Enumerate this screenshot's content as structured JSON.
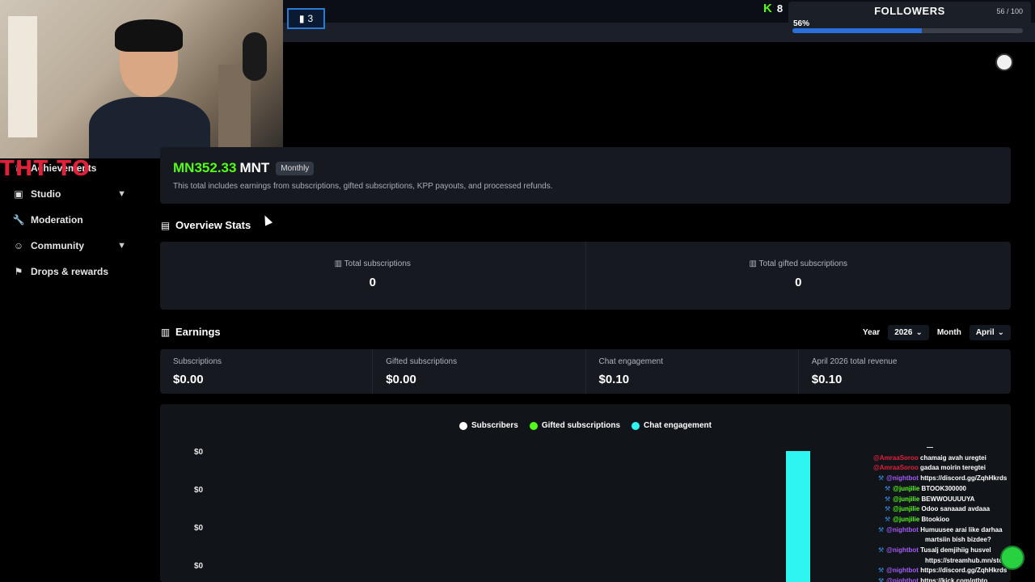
{
  "stream_overlay": {
    "tab_badge_count": "3",
    "kick_viewer_count": "8",
    "followers": {
      "title": "FOLLOWERS",
      "count": "56 / 100",
      "percent_label": "56%",
      "progress": 0.56
    },
    "logo_text": "THT TO"
  },
  "sidebar": {
    "items": [
      {
        "label": "Achievements",
        "icon": "trophy-icon"
      },
      {
        "label": "Studio",
        "icon": "studio-icon",
        "expandable": true
      },
      {
        "label": "Moderation",
        "icon": "wrench-icon"
      },
      {
        "label": "Community",
        "icon": "users-icon",
        "expandable": true
      },
      {
        "label": "Drops & rewards",
        "icon": "gift-icon"
      }
    ]
  },
  "total": {
    "prefix": "MN",
    "amount": "352.33",
    "currency": "MNT",
    "period_badge": "Monthly",
    "note": "This total includes earnings from subscriptions, gifted subscriptions, KPP payouts, and processed refunds."
  },
  "overview": {
    "title": "Overview Stats",
    "stats": [
      {
        "label": "Total subscriptions",
        "value": "0"
      },
      {
        "label": "Total gifted subscriptions",
        "value": "0"
      }
    ]
  },
  "earnings": {
    "title": "Earnings",
    "year_label": "Year",
    "year_value": "2026",
    "month_label": "Month",
    "month_value": "April",
    "cards": [
      {
        "label": "Subscriptions",
        "value": "$0.00"
      },
      {
        "label": "Gifted subscriptions",
        "value": "$0.00"
      },
      {
        "label": "Chat engagement",
        "value": "$0.10"
      },
      {
        "label": "April 2026 total revenue",
        "value": "$0.10"
      }
    ]
  },
  "chart_data": {
    "type": "bar",
    "title": "",
    "xlabel": "",
    "ylabel": "",
    "y_tick_labels": [
      "$0",
      "$0",
      "$0",
      "$0"
    ],
    "series": [
      {
        "name": "Subscribers",
        "color": "#ffffff",
        "values": [
          0
        ]
      },
      {
        "name": "Gifted subscriptions",
        "color": "#53fc18",
        "values": [
          0
        ]
      },
      {
        "name": "Chat engagement",
        "color": "#2ff5f0",
        "values": [
          0.1
        ]
      }
    ],
    "legend_position": "top-center"
  },
  "chat": [
    {
      "user": "",
      "text": "—",
      "role": "plain"
    },
    {
      "user": "@AmraaSoroo",
      "text": "chamaig avah uregtei",
      "role": "red"
    },
    {
      "user": "@AmraaSoroo",
      "text": "gadaa moirin teregtei",
      "role": "red"
    },
    {
      "user": "@nightbot",
      "text": "https://discord.gg/ZqhHkrds",
      "role": "mod-purple"
    },
    {
      "user": "@junjilie",
      "text": "BTOOK300000",
      "role": "mod-green"
    },
    {
      "user": "@junjilie",
      "text": "BEWWOUUUUYA",
      "role": "mod-green"
    },
    {
      "user": "@junjilie",
      "text": "Odoo sanaaad avdaaa",
      "role": "mod-green"
    },
    {
      "user": "@junjilie",
      "text": "Btookioo",
      "role": "mod-green"
    },
    {
      "user": "@nightbot",
      "text": "Humuusee arai like darhaa",
      "role": "mod-purple"
    },
    {
      "user": "",
      "text": "martsiin bish bizdee?",
      "role": "cont"
    },
    {
      "user": "@nightbot",
      "text": "Tusalj demjihiig husvel",
      "role": "mod-purple"
    },
    {
      "user": "",
      "text": "https://streamhub.mn/stoo",
      "role": "cont"
    },
    {
      "user": "@nightbot",
      "text": "https://discord.gg/ZqhHkrds",
      "role": "mod-purple"
    },
    {
      "user": "@nightbot",
      "text": "https://kick.com/gtbto",
      "role": "mod-purple"
    }
  ]
}
